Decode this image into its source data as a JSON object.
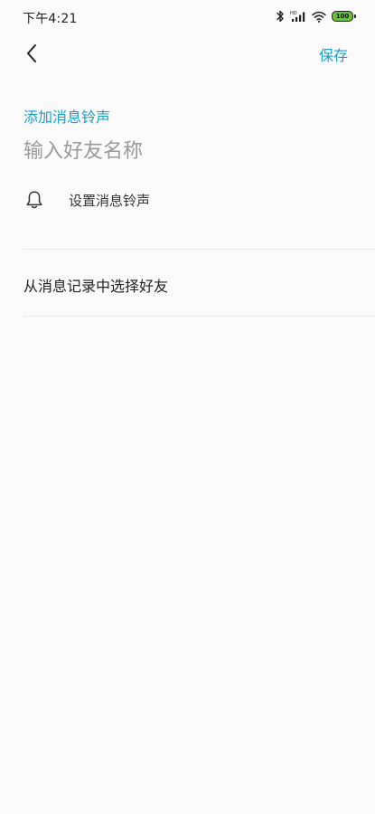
{
  "status_bar": {
    "time": "下午4:21",
    "battery": "100",
    "battery_color": "#6abf40",
    "icons": [
      "bluetooth-icon",
      "hd-signal-icon",
      "wifi-icon",
      "battery-icon"
    ]
  },
  "header": {
    "back_icon": "chevron-left-icon",
    "save_label": "保存"
  },
  "form": {
    "section_title": "添加消息铃声",
    "name_placeholder": "输入好友名称",
    "name_value": "",
    "ringtone_icon": "bell-icon",
    "ringtone_label": "设置消息铃声"
  },
  "actions": {
    "select_from_history": "从消息记录中选择好友"
  },
  "theme": {
    "accent": "#17a0c5",
    "background": "#fafafa"
  }
}
